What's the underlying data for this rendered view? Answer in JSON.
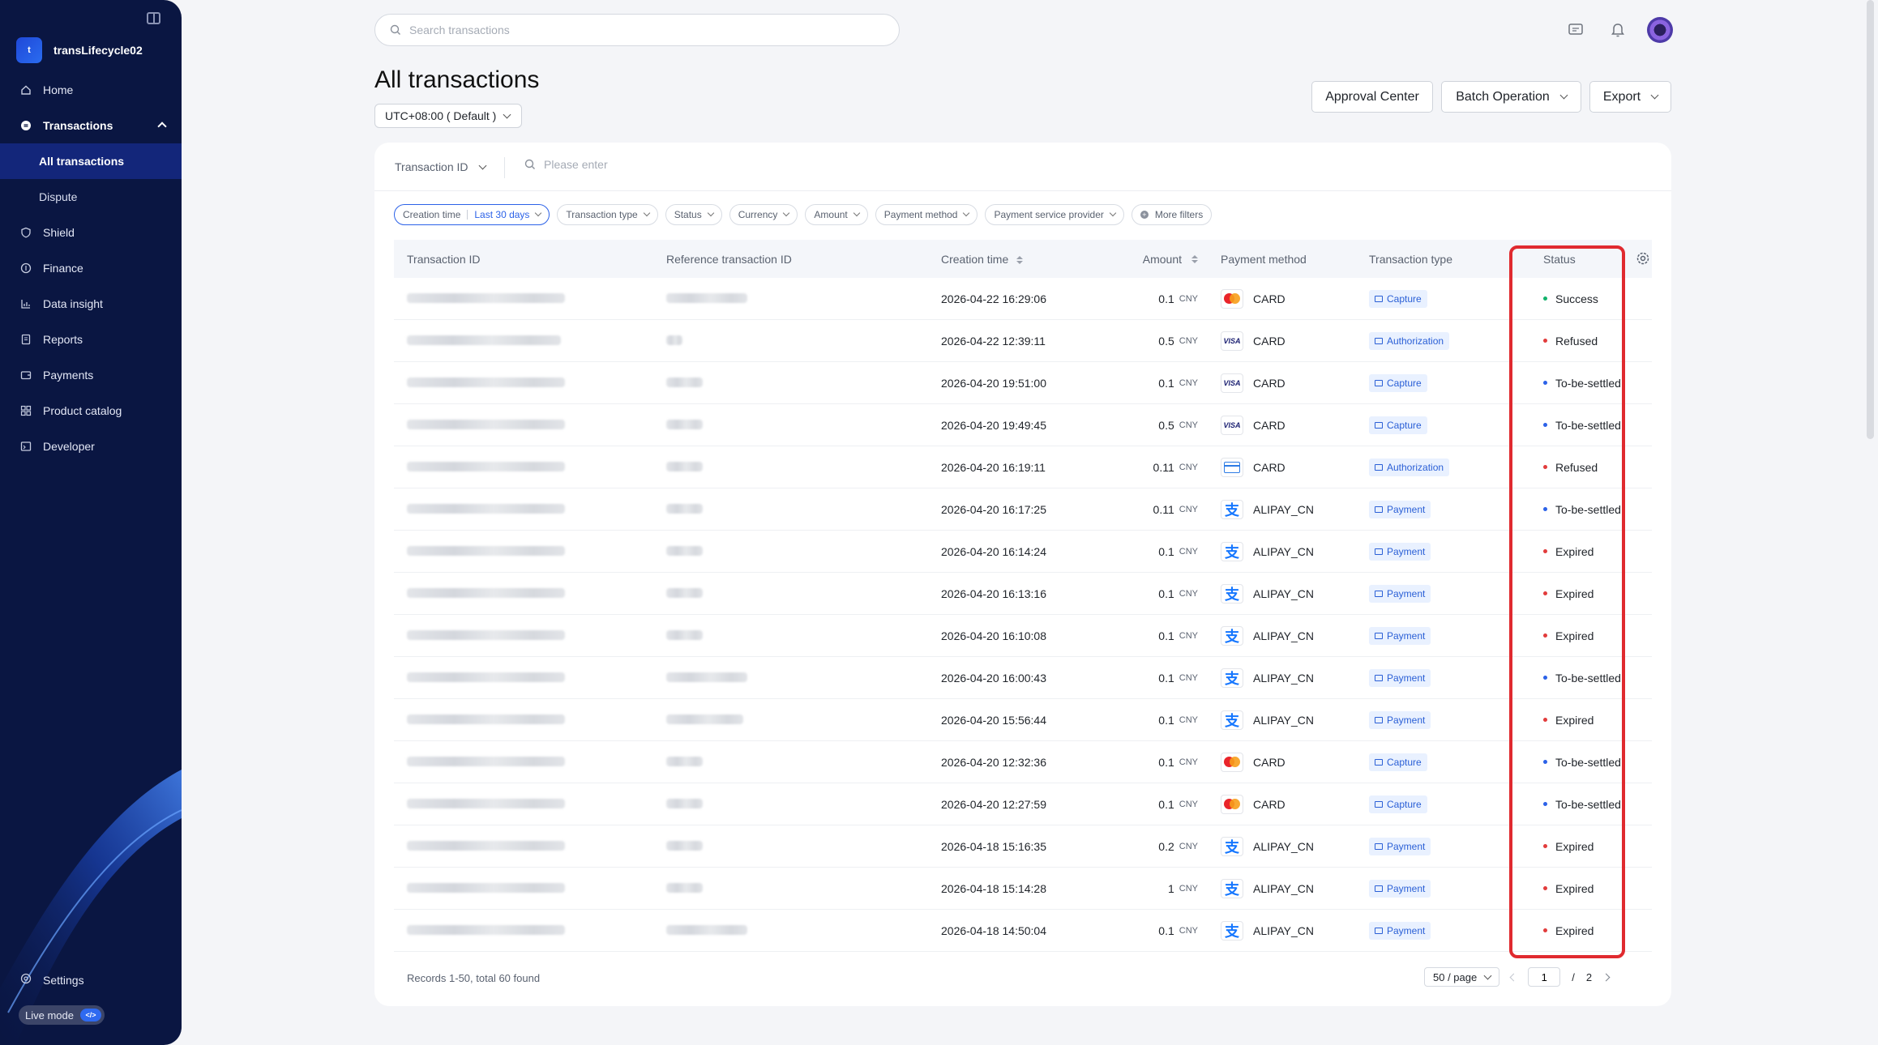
{
  "app": {
    "name": "transLifecycle02",
    "logo_letter": "t"
  },
  "sidebar": {
    "items": [
      {
        "label": "Home",
        "icon": "home-icon"
      },
      {
        "label": "Transactions",
        "icon": "transactions-icon"
      },
      {
        "label": "All transactions"
      },
      {
        "label": "Dispute"
      },
      {
        "label": "Shield",
        "icon": "shield-icon"
      },
      {
        "label": "Finance",
        "icon": "finance-icon"
      },
      {
        "label": "Data insight",
        "icon": "chart-icon"
      },
      {
        "label": "Reports",
        "icon": "reports-icon"
      },
      {
        "label": "Payments",
        "icon": "wallet-icon"
      },
      {
        "label": "Product catalog",
        "icon": "grid-icon"
      },
      {
        "label": "Developer",
        "icon": "developer-icon"
      }
    ],
    "settings_label": "Settings",
    "live_mode_label": "Live mode",
    "live_mode_toggle": "</>"
  },
  "search": {
    "placeholder": "Search transactions"
  },
  "page": {
    "title": "All transactions",
    "timezone": "UTC+08:00 ( Default )",
    "buttons": {
      "approval": "Approval Center",
      "batch": "Batch Operation",
      "export": "Export"
    }
  },
  "id_search": {
    "type_label": "Transaction ID",
    "placeholder": "Please enter"
  },
  "filters": {
    "creation_time_label": "Creation time",
    "creation_time_value": "Last 30 days",
    "transaction_type": "Transaction type",
    "status": "Status",
    "currency": "Currency",
    "amount": "Amount",
    "payment_method": "Payment method",
    "psp": "Payment service provider",
    "more": "More filters"
  },
  "table": {
    "headers": {
      "id": "Transaction ID",
      "ref": "Reference transaction ID",
      "time": "Creation time",
      "amount": "Amount",
      "payment_method": "Payment method",
      "transaction_type": "Transaction type",
      "status": "Status"
    },
    "rows": [
      {
        "time": "2026-04-22 16:29:06",
        "amount": "0.1",
        "currency": "CNY",
        "pm_logo": "mastercard",
        "pm": "CARD",
        "type": "Capture",
        "status": "Success",
        "status_kind": "ok"
      },
      {
        "time": "2026-04-22 12:39:11",
        "amount": "0.5",
        "currency": "CNY",
        "pm_logo": "visa",
        "pm": "CARD",
        "type": "Authorization",
        "status": "Refused",
        "status_kind": "bad"
      },
      {
        "time": "2026-04-20 19:51:00",
        "amount": "0.1",
        "currency": "CNY",
        "pm_logo": "visa",
        "pm": "CARD",
        "type": "Capture",
        "status": "To-be-settled",
        "status_kind": "wait"
      },
      {
        "time": "2026-04-20 19:49:45",
        "amount": "0.5",
        "currency": "CNY",
        "pm_logo": "visa",
        "pm": "CARD",
        "type": "Capture",
        "status": "To-be-settled",
        "status_kind": "wait"
      },
      {
        "time": "2026-04-20 16:19:11",
        "amount": "0.11",
        "currency": "CNY",
        "pm_logo": "card",
        "pm": "CARD",
        "type": "Authorization",
        "status": "Refused",
        "status_kind": "bad"
      },
      {
        "time": "2026-04-20 16:17:25",
        "amount": "0.11",
        "currency": "CNY",
        "pm_logo": "alipay",
        "pm": "ALIPAY_CN",
        "type": "Payment",
        "status": "To-be-settled",
        "status_kind": "wait"
      },
      {
        "time": "2026-04-20 16:14:24",
        "amount": "0.1",
        "currency": "CNY",
        "pm_logo": "alipay",
        "pm": "ALIPAY_CN",
        "type": "Payment",
        "status": "Expired",
        "status_kind": "bad"
      },
      {
        "time": "2026-04-20 16:13:16",
        "amount": "0.1",
        "currency": "CNY",
        "pm_logo": "alipay",
        "pm": "ALIPAY_CN",
        "type": "Payment",
        "status": "Expired",
        "status_kind": "bad"
      },
      {
        "time": "2026-04-20 16:10:08",
        "amount": "0.1",
        "currency": "CNY",
        "pm_logo": "alipay",
        "pm": "ALIPAY_CN",
        "type": "Payment",
        "status": "Expired",
        "status_kind": "bad"
      },
      {
        "time": "2026-04-20 16:00:43",
        "amount": "0.1",
        "currency": "CNY",
        "pm_logo": "alipay",
        "pm": "ALIPAY_CN",
        "type": "Payment",
        "status": "To-be-settled",
        "status_kind": "wait"
      },
      {
        "time": "2026-04-20 15:56:44",
        "amount": "0.1",
        "currency": "CNY",
        "pm_logo": "alipay",
        "pm": "ALIPAY_CN",
        "type": "Payment",
        "status": "Expired",
        "status_kind": "bad"
      },
      {
        "time": "2026-04-20 12:32:36",
        "amount": "0.1",
        "currency": "CNY",
        "pm_logo": "mastercard",
        "pm": "CARD",
        "type": "Capture",
        "status": "To-be-settled",
        "status_kind": "wait"
      },
      {
        "time": "2026-04-20 12:27:59",
        "amount": "0.1",
        "currency": "CNY",
        "pm_logo": "mastercard",
        "pm": "CARD",
        "type": "Capture",
        "status": "To-be-settled",
        "status_kind": "wait"
      },
      {
        "time": "2026-04-18 15:16:35",
        "amount": "0.2",
        "currency": "CNY",
        "pm_logo": "alipay",
        "pm": "ALIPAY_CN",
        "type": "Payment",
        "status": "Expired",
        "status_kind": "bad"
      },
      {
        "time": "2026-04-18 15:14:28",
        "amount": "1",
        "currency": "CNY",
        "pm_logo": "alipay",
        "pm": "ALIPAY_CN",
        "type": "Payment",
        "status": "Expired",
        "status_kind": "bad"
      },
      {
        "time": "2026-04-18 14:50:04",
        "amount": "0.1",
        "currency": "CNY",
        "pm_logo": "alipay",
        "pm": "ALIPAY_CN",
        "type": "Payment",
        "status": "Expired",
        "status_kind": "bad"
      }
    ]
  },
  "footer": {
    "records": "Records 1-50, total 60 found",
    "page_size": "50 / page",
    "current_page": "1",
    "separator": "/",
    "total_pages": "2"
  },
  "colors": {
    "sidebar_bg": "#0a1642",
    "accent": "#2c62e8",
    "success": "#12b26b",
    "error": "#e23c3c",
    "highlight": "#e02a2f"
  }
}
